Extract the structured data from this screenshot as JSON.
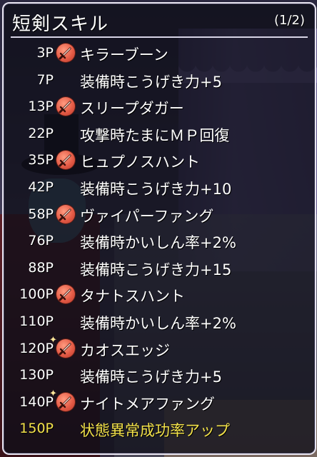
{
  "window": {
    "title": "短剣スキル",
    "page_indicator": "(1/2)"
  },
  "skills": [
    {
      "points": "3P",
      "name": "キラーブーン",
      "icon": "dagger-skill-icon",
      "sparkle": false,
      "highlight": false
    },
    {
      "points": "7P",
      "name": "装備時こうげき力+5",
      "icon": null,
      "sparkle": false,
      "highlight": false
    },
    {
      "points": "13P",
      "name": "スリープダガー",
      "icon": "dagger-skill-icon",
      "sparkle": false,
      "highlight": false
    },
    {
      "points": "22P",
      "name": "攻撃時たまにＭＰ回復",
      "icon": null,
      "sparkle": false,
      "highlight": false
    },
    {
      "points": "35P",
      "name": "ヒュプノスハント",
      "icon": "dagger-skill-icon",
      "sparkle": false,
      "highlight": false
    },
    {
      "points": "42P",
      "name": "装備時こうげき力+10",
      "icon": null,
      "sparkle": false,
      "highlight": false
    },
    {
      "points": "58P",
      "name": "ヴァイパーファング",
      "icon": "dagger-skill-icon",
      "sparkle": false,
      "highlight": false
    },
    {
      "points": "76P",
      "name": "装備時かいしん率+2%",
      "icon": null,
      "sparkle": false,
      "highlight": false
    },
    {
      "points": "88P",
      "name": "装備時こうげき力+15",
      "icon": null,
      "sparkle": false,
      "highlight": false
    },
    {
      "points": "100P",
      "name": "タナトスハント",
      "icon": "dagger-skill-icon",
      "sparkle": false,
      "highlight": false
    },
    {
      "points": "110P",
      "name": "装備時かいしん率+2%",
      "icon": null,
      "sparkle": false,
      "highlight": false
    },
    {
      "points": "120P",
      "name": "カオスエッジ",
      "icon": "dagger-skill-icon",
      "sparkle": true,
      "highlight": false
    },
    {
      "points": "130P",
      "name": "装備時こうげき力+5",
      "icon": null,
      "sparkle": false,
      "highlight": false
    },
    {
      "points": "140P",
      "name": "ナイトメアファング",
      "icon": "dagger-skill-icon",
      "sparkle": true,
      "highlight": false
    },
    {
      "points": "150P",
      "name": "状態異常成功率アップ",
      "icon": null,
      "sparkle": false,
      "highlight": true
    }
  ],
  "colors": {
    "text": "#ffffff",
    "highlight_text": "#f2e14a",
    "skill_icon": "#e45b46",
    "border": "#e9e6f2"
  }
}
